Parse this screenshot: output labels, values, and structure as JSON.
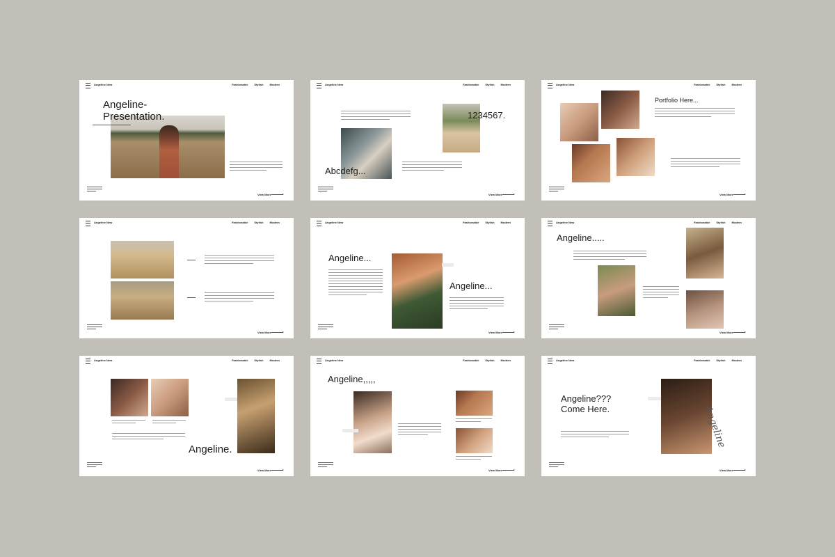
{
  "header": {
    "brand": "Angeline New",
    "nav": [
      "Fashionable",
      "Stylish",
      "Modern"
    ]
  },
  "footer": {
    "view_more": "View More"
  },
  "slides": {
    "s1": {
      "title_line1": "Angeline-",
      "title_line2": "Presentation."
    },
    "s2": {
      "numbers": "1234567.",
      "letters": "Abcdefg..."
    },
    "s3": {
      "title": "Portfolio Here..."
    },
    "s5": {
      "title_a": "Angeline...",
      "title_b": "Angeline..."
    },
    "s6": {
      "title": "Angeline....."
    },
    "s7": {
      "title": "Angeline."
    },
    "s8": {
      "title": "Angeline,,,,,"
    },
    "s9": {
      "title_line1": "Angeline???",
      "title_line2": "Come Here.",
      "signature": "Angeline"
    }
  },
  "colors": {
    "background": "#c2beb8",
    "slide": "#ffffff",
    "text": "#1d1d1d"
  }
}
